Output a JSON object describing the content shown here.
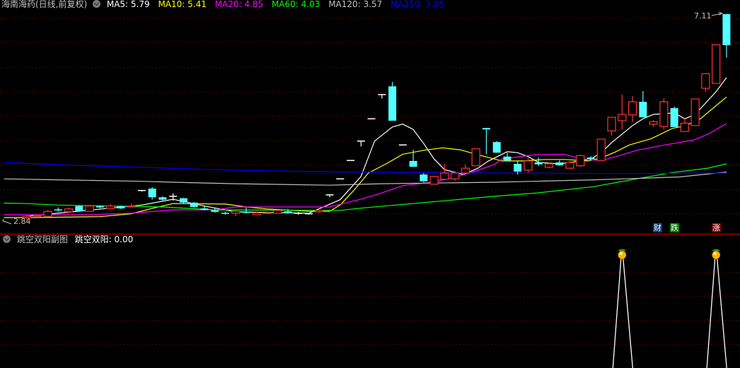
{
  "header": {
    "title": "海南海药(日线,前复权)",
    "ma": [
      {
        "label": "MA5: 5.79",
        "color": "#ffffff"
      },
      {
        "label": "MA10: 5.41",
        "color": "#ffff00"
      },
      {
        "label": "MA20: 4.85",
        "color": "#ff00ff"
      },
      {
        "label": "MA60: 4.03",
        "color": "#00ff00"
      },
      {
        "label": "MA120: 3.57",
        "color": "#c0c0c0"
      },
      {
        "label": "MA250: 3.85",
        "color": "#0000ff"
      }
    ]
  },
  "sub_panel": {
    "title": "跳空双阳副图",
    "indicator": "跳空双阳: 0.00"
  },
  "badges": [
    {
      "label": "财",
      "color": "#003c7a"
    },
    {
      "label": "跌",
      "color": "#007a00"
    },
    {
      "label": "涨",
      "color": "#7a0000"
    }
  ],
  "colors": {
    "up": "#ff3232",
    "down": "#54ffff",
    "flat": "#ffffff",
    "grid": "#8a0000",
    "separator": "#a00000"
  },
  "chart_data": {
    "type": "candlestick",
    "price_range": [
      2.84,
      7.11
    ],
    "high_label": "7.11",
    "low_label": "2.84",
    "candles_ohlc": [
      [
        2.91,
        2.96,
        2.84,
        2.94
      ],
      [
        2.94,
        2.97,
        2.91,
        2.96
      ],
      [
        2.94,
        3.07,
        2.93,
        3.04
      ],
      [
        3.08,
        3.12,
        3.03,
        3.07
      ],
      [
        3.03,
        3.12,
        3.01,
        3.09
      ],
      [
        3.15,
        3.16,
        3.03,
        3.04
      ],
      [
        3.04,
        3.17,
        3.03,
        3.15
      ],
      [
        3.15,
        3.16,
        3.1,
        3.12
      ],
      [
        3.1,
        3.19,
        3.09,
        3.15
      ],
      [
        3.15,
        3.16,
        3.09,
        3.1
      ],
      [
        3.13,
        3.2,
        3.12,
        3.15
      ],
      [
        3.47,
        3.47,
        3.45,
        3.47
      ],
      [
        3.51,
        3.54,
        3.28,
        3.33
      ],
      [
        3.33,
        3.35,
        3.26,
        3.28
      ],
      [
        3.35,
        3.41,
        3.26,
        3.35
      ],
      [
        3.31,
        3.32,
        3.2,
        3.22
      ],
      [
        3.22,
        3.23,
        3.12,
        3.13
      ],
      [
        3.1,
        3.15,
        3.06,
        3.07
      ],
      [
        3.06,
        3.12,
        3.01,
        3.03
      ],
      [
        3.01,
        3.03,
        2.97,
        2.99
      ],
      [
        3.0,
        3.06,
        2.94,
        3.04
      ],
      [
        3.03,
        3.12,
        3.0,
        3.01
      ],
      [
        2.97,
        3.03,
        2.96,
        3.01
      ],
      [
        3.0,
        3.03,
        2.99,
        3.01
      ],
      [
        3.0,
        3.07,
        2.99,
        3.06
      ],
      [
        3.04,
        3.09,
        2.99,
        3.0
      ],
      [
        3.0,
        3.03,
        2.97,
        3.0
      ],
      [
        2.99,
        2.99,
        2.97,
        2.99
      ],
      [
        3.03,
        3.07,
        3.01,
        3.06
      ],
      [
        3.38,
        3.38,
        3.33,
        3.38
      ],
      [
        3.71,
        3.71,
        3.71,
        3.71
      ],
      [
        4.09,
        4.09,
        4.09,
        4.09
      ],
      [
        4.49,
        4.49,
        4.38,
        4.49
      ],
      [
        4.95,
        4.95,
        4.95,
        4.95
      ],
      [
        5.45,
        5.45,
        5.37,
        5.45
      ],
      [
        5.62,
        5.71,
        4.91,
        4.91
      ],
      [
        4.41,
        4.41,
        4.41,
        4.41
      ],
      [
        4.08,
        4.31,
        3.96,
        3.96
      ],
      [
        3.8,
        3.83,
        3.64,
        3.66
      ],
      [
        3.6,
        3.77,
        3.6,
        3.76
      ],
      [
        3.7,
        4.02,
        3.68,
        3.83
      ],
      [
        3.71,
        3.84,
        3.67,
        3.83
      ],
      [
        3.83,
        4.01,
        3.83,
        3.93
      ],
      [
        3.98,
        4.33,
        3.98,
        4.33
      ],
      [
        4.76,
        4.76,
        4.22,
        4.73
      ],
      [
        4.47,
        4.49,
        4.25,
        4.25
      ],
      [
        4.17,
        4.25,
        4.08,
        4.09
      ],
      [
        4.02,
        4.09,
        3.8,
        3.86
      ],
      [
        3.89,
        4.14,
        3.84,
        4.08
      ],
      [
        4.05,
        4.15,
        3.98,
        4.01
      ],
      [
        3.95,
        4.05,
        3.93,
        4.02
      ],
      [
        4.05,
        4.09,
        3.98,
        3.99
      ],
      [
        3.93,
        4.08,
        3.92,
        4.05
      ],
      [
        3.98,
        4.21,
        3.96,
        4.19
      ],
      [
        4.15,
        4.18,
        4.09,
        4.12
      ],
      [
        4.09,
        4.53,
        4.09,
        4.53
      ],
      [
        4.7,
        4.98,
        4.6,
        4.98
      ],
      [
        4.91,
        5.45,
        4.73,
        5.04
      ],
      [
        5.03,
        5.42,
        4.88,
        5.3
      ],
      [
        5.3,
        5.52,
        4.98,
        4.98
      ],
      [
        4.84,
        4.92,
        4.78,
        4.89
      ],
      [
        4.79,
        5.37,
        4.73,
        5.3
      ],
      [
        5.17,
        5.2,
        4.78,
        4.78
      ],
      [
        4.69,
        4.95,
        4.69,
        4.86
      ],
      [
        4.81,
        5.36,
        4.81,
        5.36
      ],
      [
        5.58,
        5.88,
        5.51,
        5.88
      ],
      [
        5.68,
        6.48,
        5.68,
        6.48
      ],
      [
        7.11,
        7.11,
        6.21,
        6.47
      ]
    ],
    "moving_averages": [
      {
        "name": "MA5",
        "color": "#ffffff",
        "points": [
          [
            0,
            2.94
          ],
          [
            11,
            3.17
          ],
          [
            14,
            3.29
          ],
          [
            17,
            3.15
          ],
          [
            20,
            3.03
          ],
          [
            27,
            3.0
          ],
          [
            30,
            3.28
          ],
          [
            32,
            3.76
          ],
          [
            33.3,
            4.49
          ],
          [
            35,
            4.78
          ],
          [
            36,
            4.84
          ],
          [
            37,
            4.73
          ],
          [
            38,
            4.44
          ],
          [
            39,
            4.12
          ],
          [
            40,
            3.9
          ],
          [
            41.8,
            3.8
          ],
          [
            43.2,
            3.93
          ],
          [
            44.2,
            4.08
          ],
          [
            46,
            4.27
          ],
          [
            47,
            4.25
          ],
          [
            48,
            4.17
          ],
          [
            49,
            4.05
          ],
          [
            51,
            4.02
          ],
          [
            53,
            4.08
          ],
          [
            54,
            4.12
          ],
          [
            55,
            4.25
          ],
          [
            56,
            4.46
          ],
          [
            58,
            4.81
          ],
          [
            59,
            4.95
          ],
          [
            60,
            5.04
          ],
          [
            62,
            5.07
          ],
          [
            63,
            4.95
          ],
          [
            64,
            5.04
          ],
          [
            66,
            5.51
          ],
          [
            67,
            5.8
          ]
        ]
      },
      {
        "name": "MA10",
        "color": "#ffff00",
        "points": [
          [
            -2.2,
            2.91
          ],
          [
            0,
            2.91
          ],
          [
            7,
            2.93
          ],
          [
            10,
            2.99
          ],
          [
            12,
            3.1
          ],
          [
            14,
            3.2
          ],
          [
            19,
            3.19
          ],
          [
            21,
            3.13
          ],
          [
            23,
            3.09
          ],
          [
            27,
            3.04
          ],
          [
            29,
            3.04
          ],
          [
            30,
            3.17
          ],
          [
            31.3,
            3.47
          ],
          [
            32.7,
            3.83
          ],
          [
            34.4,
            4.02
          ],
          [
            36,
            4.22
          ],
          [
            38,
            4.3
          ],
          [
            39.8,
            4.35
          ],
          [
            41.5,
            4.31
          ],
          [
            43.5,
            4.19
          ],
          [
            45.5,
            4.08
          ],
          [
            47.5,
            4.08
          ],
          [
            49.6,
            4.11
          ],
          [
            51.6,
            4.11
          ],
          [
            53.7,
            4.08
          ],
          [
            55,
            4.14
          ],
          [
            56.4,
            4.27
          ],
          [
            57.7,
            4.41
          ],
          [
            59.8,
            4.54
          ],
          [
            61.8,
            4.75
          ],
          [
            63.1,
            4.81
          ],
          [
            64.5,
            4.95
          ],
          [
            67,
            5.4
          ]
        ]
      },
      {
        "name": "MA20",
        "color": "#ff00ff",
        "points": [
          [
            -2.2,
            2.97
          ],
          [
            0,
            2.97
          ],
          [
            6,
            2.97
          ],
          [
            10,
            3.0
          ],
          [
            14,
            3.07
          ],
          [
            18,
            3.07
          ],
          [
            20,
            3.13
          ],
          [
            29,
            3.13
          ],
          [
            30.6,
            3.22
          ],
          [
            32,
            3.29
          ],
          [
            34,
            3.42
          ],
          [
            36,
            3.57
          ],
          [
            38.7,
            3.64
          ],
          [
            40.8,
            3.73
          ],
          [
            42.8,
            3.86
          ],
          [
            44.8,
            4.01
          ],
          [
            45.5,
            4.12
          ],
          [
            48.7,
            4.21
          ],
          [
            51.4,
            4.22
          ],
          [
            53.2,
            4.12
          ],
          [
            55,
            4.09
          ],
          [
            56.4,
            4.17
          ],
          [
            58.4,
            4.3
          ],
          [
            61.1,
            4.41
          ],
          [
            63.8,
            4.51
          ],
          [
            65.2,
            4.63
          ],
          [
            67,
            4.85
          ]
        ]
      },
      {
        "name": "MA60",
        "color": "#00ff00",
        "points": [
          [
            -2.2,
            3.21
          ],
          [
            0,
            3.2
          ],
          [
            3,
            3.17
          ],
          [
            8,
            3.15
          ],
          [
            13,
            3.13
          ],
          [
            18,
            3.07
          ],
          [
            27,
            3.06
          ],
          [
            30,
            3.06
          ],
          [
            32.7,
            3.12
          ],
          [
            38,
            3.22
          ],
          [
            44.8,
            3.35
          ],
          [
            48.9,
            3.42
          ],
          [
            54.3,
            3.55
          ],
          [
            58.4,
            3.71
          ],
          [
            61.8,
            3.84
          ],
          [
            65.2,
            3.93
          ],
          [
            67,
            4.02
          ]
        ]
      },
      {
        "name": "MA120",
        "color": "#c0c0c0",
        "points": [
          [
            -2.2,
            3.71
          ],
          [
            3,
            3.69
          ],
          [
            11,
            3.66
          ],
          [
            14,
            3.64
          ],
          [
            20,
            3.61
          ],
          [
            29,
            3.58
          ],
          [
            34,
            3.61
          ],
          [
            44.8,
            3.64
          ],
          [
            54.3,
            3.69
          ],
          [
            58.4,
            3.72
          ],
          [
            62.5,
            3.75
          ],
          [
            67,
            3.85
          ]
        ]
      },
      {
        "name": "MA250",
        "color": "#0000ff",
        "points": [
          [
            -2.2,
            4.05
          ],
          [
            4.2,
            3.99
          ],
          [
            11,
            3.95
          ],
          [
            17.8,
            3.9
          ],
          [
            27.2,
            3.86
          ],
          [
            44.8,
            3.83
          ],
          [
            56.4,
            3.82
          ],
          [
            67,
            3.83
          ]
        ]
      }
    ],
    "sub_signals": {
      "name": "跳空双阳",
      "signal_indices": [
        57,
        66
      ],
      "current_value": 0.0
    }
  }
}
